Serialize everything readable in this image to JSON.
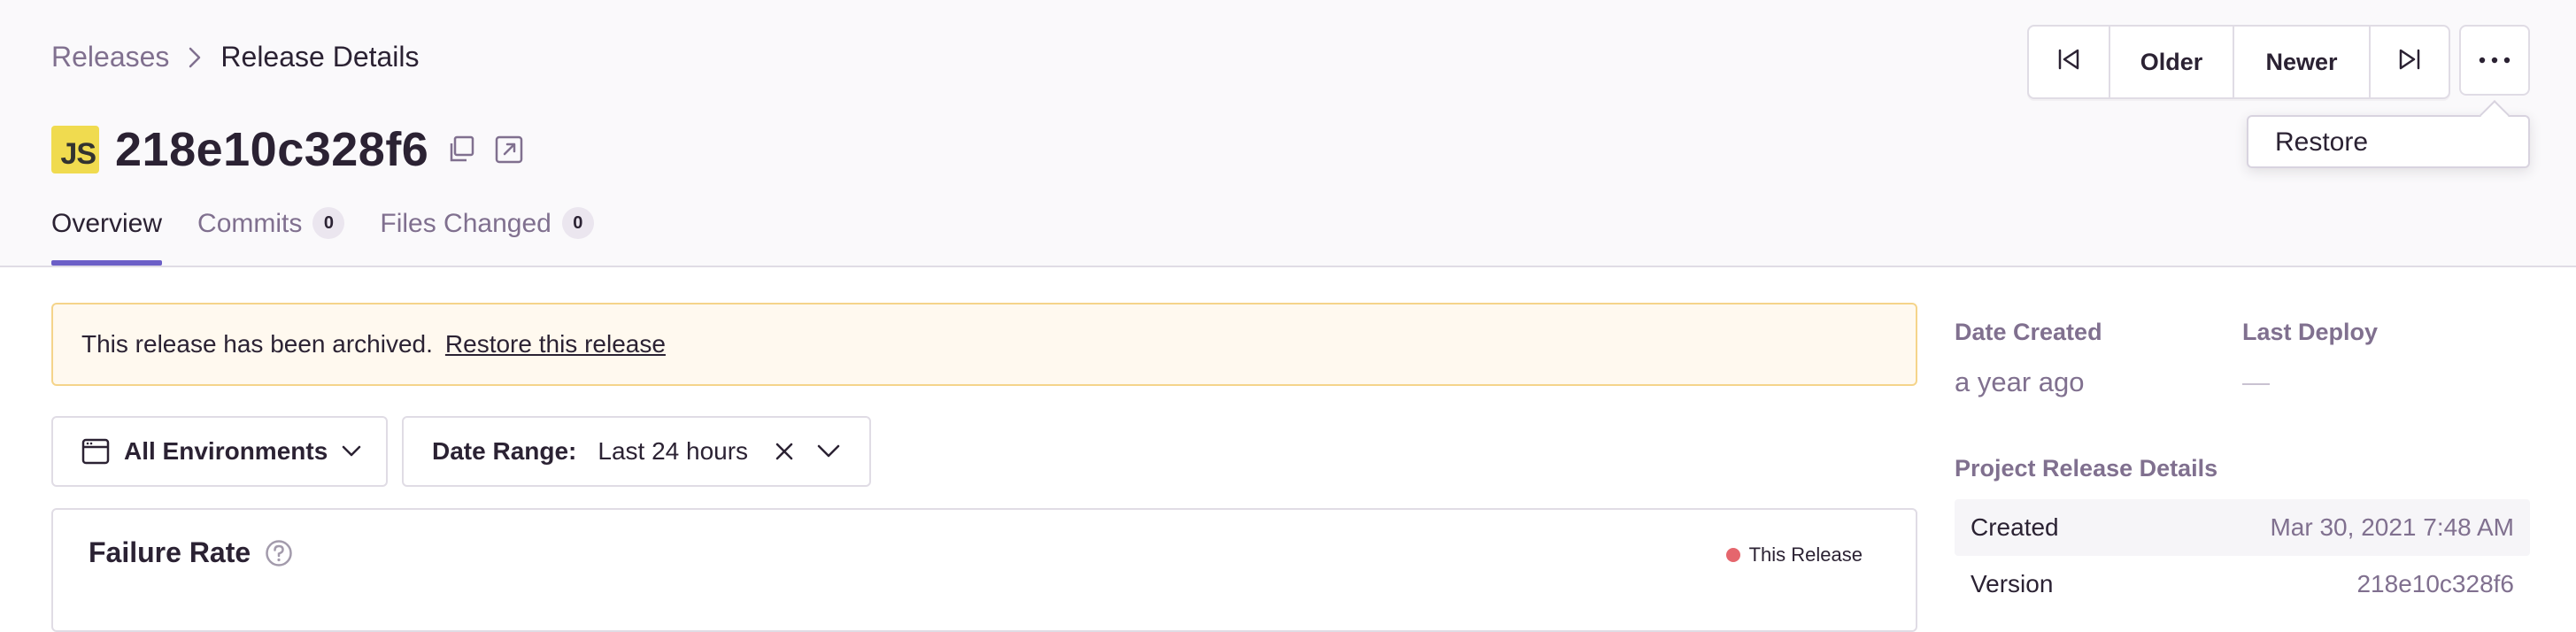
{
  "breadcrumb": {
    "parent": "Releases",
    "current": "Release Details"
  },
  "nav": {
    "older": "Older",
    "newer": "Newer"
  },
  "menu": {
    "restore": "Restore"
  },
  "release": {
    "platform_badge": "JS",
    "version": "218e10c328f6"
  },
  "tabs": [
    {
      "label": "Overview",
      "active": true
    },
    {
      "label": "Commits",
      "count": "0"
    },
    {
      "label": "Files Changed",
      "count": "0"
    }
  ],
  "alert": {
    "message": "This release has been archived.",
    "link": "Restore this release"
  },
  "filters": {
    "environment": "All Environments",
    "date_range_label": "Date Range:",
    "date_range_value": "Last 24 hours"
  },
  "chart": {
    "title": "Failure Rate",
    "legend": "This Release",
    "legend_color": "#e5666d"
  },
  "sidebar": {
    "date_created_label": "Date Created",
    "date_created_value": "a year ago",
    "last_deploy_label": "Last Deploy",
    "last_deploy_value": "—",
    "project_details_label": "Project Release Details",
    "rows": [
      {
        "key": "Created",
        "value": "Mar 30, 2021 7:48 AM"
      },
      {
        "key": "Version",
        "value": "218e10c328f6"
      }
    ]
  },
  "colors": {
    "accent": "#6c5fc7",
    "text": "#2b2233",
    "muted": "#80708f",
    "alert_bg": "#fff9ef",
    "alert_border": "#f5d48a"
  }
}
